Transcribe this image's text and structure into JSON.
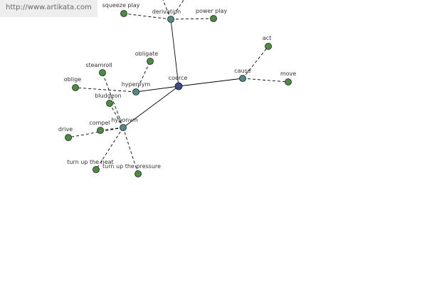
{
  "site": {
    "url": "http://www.artikata.com"
  },
  "colors": {
    "center": "#3b4a8c",
    "relation": "#4f8a8b",
    "leaf": "#4d8b43",
    "edge": "#000000",
    "label": "#333333",
    "banner": "#eeeeee"
  },
  "graph": {
    "center": {
      "id": "coerce",
      "label": "coerce"
    },
    "relations": [
      {
        "id": "derivation",
        "label": "derivation"
      },
      {
        "id": "cause",
        "label": "cause"
      },
      {
        "id": "hypernym",
        "label": "hypernym"
      },
      {
        "id": "hyponym",
        "label": "hyponym"
      }
    ],
    "leaves": [
      {
        "id": "squeeze-play",
        "label": "squeeze play",
        "parent": "derivation"
      },
      {
        "id": "power-play",
        "label": "power play",
        "parent": "derivation"
      },
      {
        "id": "act",
        "label": "act",
        "parent": "cause"
      },
      {
        "id": "move",
        "label": "move",
        "parent": "cause"
      },
      {
        "id": "obligate",
        "label": "obligate",
        "parent": "hypernym"
      },
      {
        "id": "oblige",
        "label": "oblige",
        "parent": "hypernym"
      },
      {
        "id": "steamroll",
        "label": "steamroll",
        "parent": "hyponym"
      },
      {
        "id": "bludgeon",
        "label": "bludgeon",
        "parent": "hyponym"
      },
      {
        "id": "compel",
        "label": "compel",
        "parent": "hyponym"
      },
      {
        "id": "drive",
        "label": "drive",
        "parent": "hyponym"
      },
      {
        "id": "turn-up-the-heat",
        "label": "turn up the heat",
        "parent": "hyponym"
      },
      {
        "id": "turn-up-the-pressure",
        "label": "turn up the pressure",
        "parent": "hyponym"
      }
    ]
  }
}
